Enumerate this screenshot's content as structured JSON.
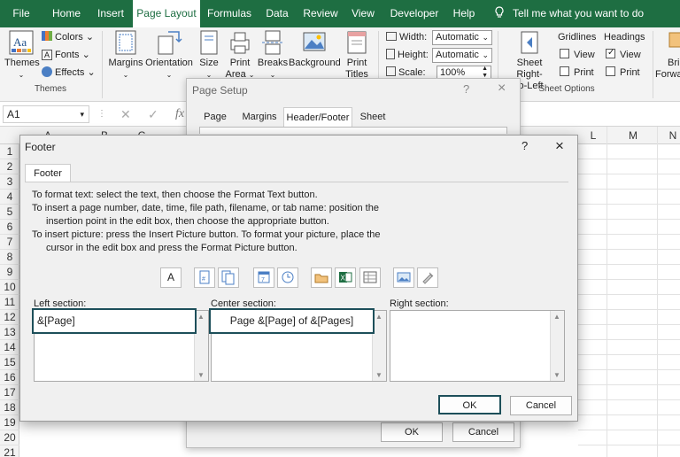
{
  "ribbon_tabs": [
    "File",
    "Home",
    "Insert",
    "Page Layout",
    "Formulas",
    "Data",
    "Review",
    "View",
    "Developer",
    "Help"
  ],
  "active_tab": "Page Layout",
  "tell_me": "Tell me what you want to do",
  "themes_group": {
    "themes_label": "Themes",
    "colors": "Colors",
    "fonts": "Fonts",
    "effects": "Effects",
    "group_label": "Themes"
  },
  "page_setup_group": {
    "margins": "Margins",
    "orientation": "Orientation",
    "size": "Size",
    "print_area_1": "Print",
    "print_area_2": "Area",
    "breaks": "Breaks",
    "background": "Background",
    "print_titles_1": "Print",
    "print_titles_2": "Titles"
  },
  "scale_group": {
    "width_label": "Width:",
    "width_value": "Automatic",
    "height_label": "Height:",
    "height_value": "Automatic",
    "scale_label": "Scale:",
    "scale_value": "100%"
  },
  "sheet_options_group": {
    "sheet_rtl_1": "Sheet Right-",
    "sheet_rtl_2": "to-Left",
    "gridlines": "Gridlines",
    "headings": "Headings",
    "view": "View",
    "print": "Print",
    "group_label": "Sheet Options",
    "bring_forward_1": "Brin",
    "bring_forward_2": "Forwa"
  },
  "formula_bar": {
    "name_box": "A1",
    "fx": "fx"
  },
  "columns": [
    "A",
    "B",
    "C",
    "L",
    "M",
    "N"
  ],
  "rows": [
    "1",
    "2",
    "3",
    "4",
    "5",
    "6",
    "7",
    "8",
    "9",
    "10",
    "11",
    "12",
    "13",
    "14",
    "15",
    "16",
    "17",
    "18",
    "19",
    "20",
    "21"
  ],
  "page_setup_dialog": {
    "title": "Page Setup",
    "help": "?",
    "close": "×",
    "tabs": [
      "Page",
      "Margins",
      "Header/Footer",
      "Sheet"
    ],
    "ok": "OK",
    "cancel": "Cancel"
  },
  "footer_dialog": {
    "title": "Footer",
    "help": "?",
    "close": "×",
    "tab": "Footer",
    "instructions": [
      "To format text:  select the text, then choose the Format Text button.",
      "To insert a page number, date, time, file path, filename, or tab name:  position the",
      "    insertion point in the edit box, then choose the appropriate button.",
      "To insert picture: press the Insert Picture button.  To format your picture, place the",
      "    cursor in the edit box and press the Format Picture button."
    ],
    "left_label": "Left section:",
    "left_value": "&[Page]",
    "center_label": "Center section:",
    "center_value": "Page &[Page] of &[Pages]",
    "right_label": "Right section:",
    "right_value": "",
    "ok": "OK",
    "cancel": "Cancel"
  },
  "colors": {
    "ribbon_green": "#1e6e42",
    "focus_border": "#1d4f5a"
  }
}
